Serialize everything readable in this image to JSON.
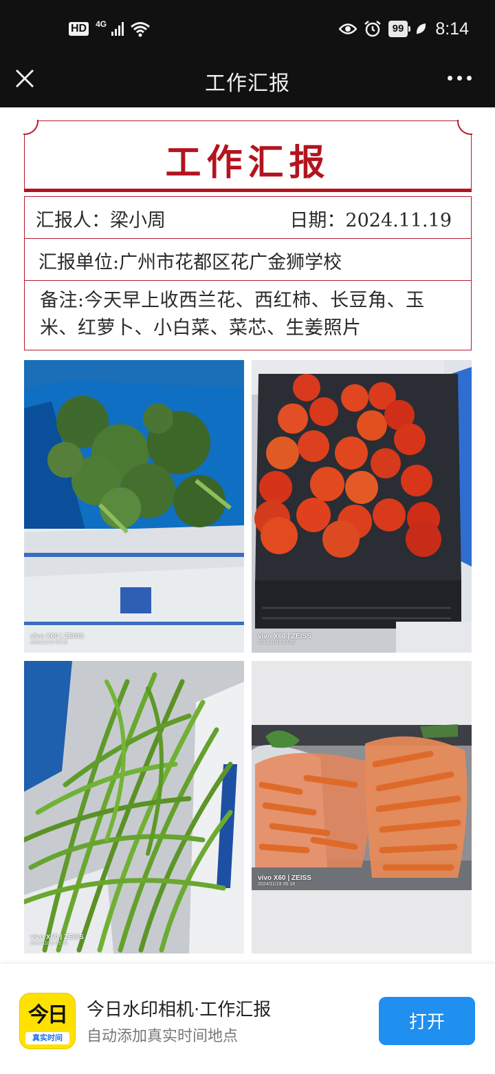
{
  "status_bar": {
    "hd": "HD",
    "network": "4G",
    "battery": "99",
    "time": "8:14"
  },
  "nav": {
    "title": "工作汇报",
    "close_icon": "close-icon",
    "more_icon": "more-icon"
  },
  "report": {
    "title": "工作汇报",
    "reporter": "汇报人：梁小周",
    "date": "日期：2024.11.19",
    "unit": "汇报单位:广州市花都区花广金狮学校",
    "note": "备注:今天早上收西兰花、西红柿、长豆角、玉米、红萝卜、小白菜、菜芯、生姜照片",
    "accent_color": "#b3141f"
  },
  "photos": [
    {
      "subject": "broccoli",
      "brand": "vivo X60 | ZEISS",
      "timestamp": "2024/11/19 05:20"
    },
    {
      "subject": "tomatoes",
      "brand": "vivo X60 | ZEISS",
      "timestamp": "2024/11/19 05:19"
    },
    {
      "subject": "long beans",
      "brand": "vivo X60 | ZEISS",
      "timestamp": "2024/11/19 05:20"
    },
    {
      "subject": "carrots",
      "brand": "vivo X60 | ZEISS",
      "timestamp": "2024/11/19 05:18"
    }
  ],
  "banner": {
    "app_icon_top": "今日",
    "app_icon_bottom": "真实时间",
    "title": "今日水印相机·工作汇报",
    "subtitle": "自动添加真实时间地点",
    "open_button": "打开",
    "button_color": "#1f8ff0"
  }
}
